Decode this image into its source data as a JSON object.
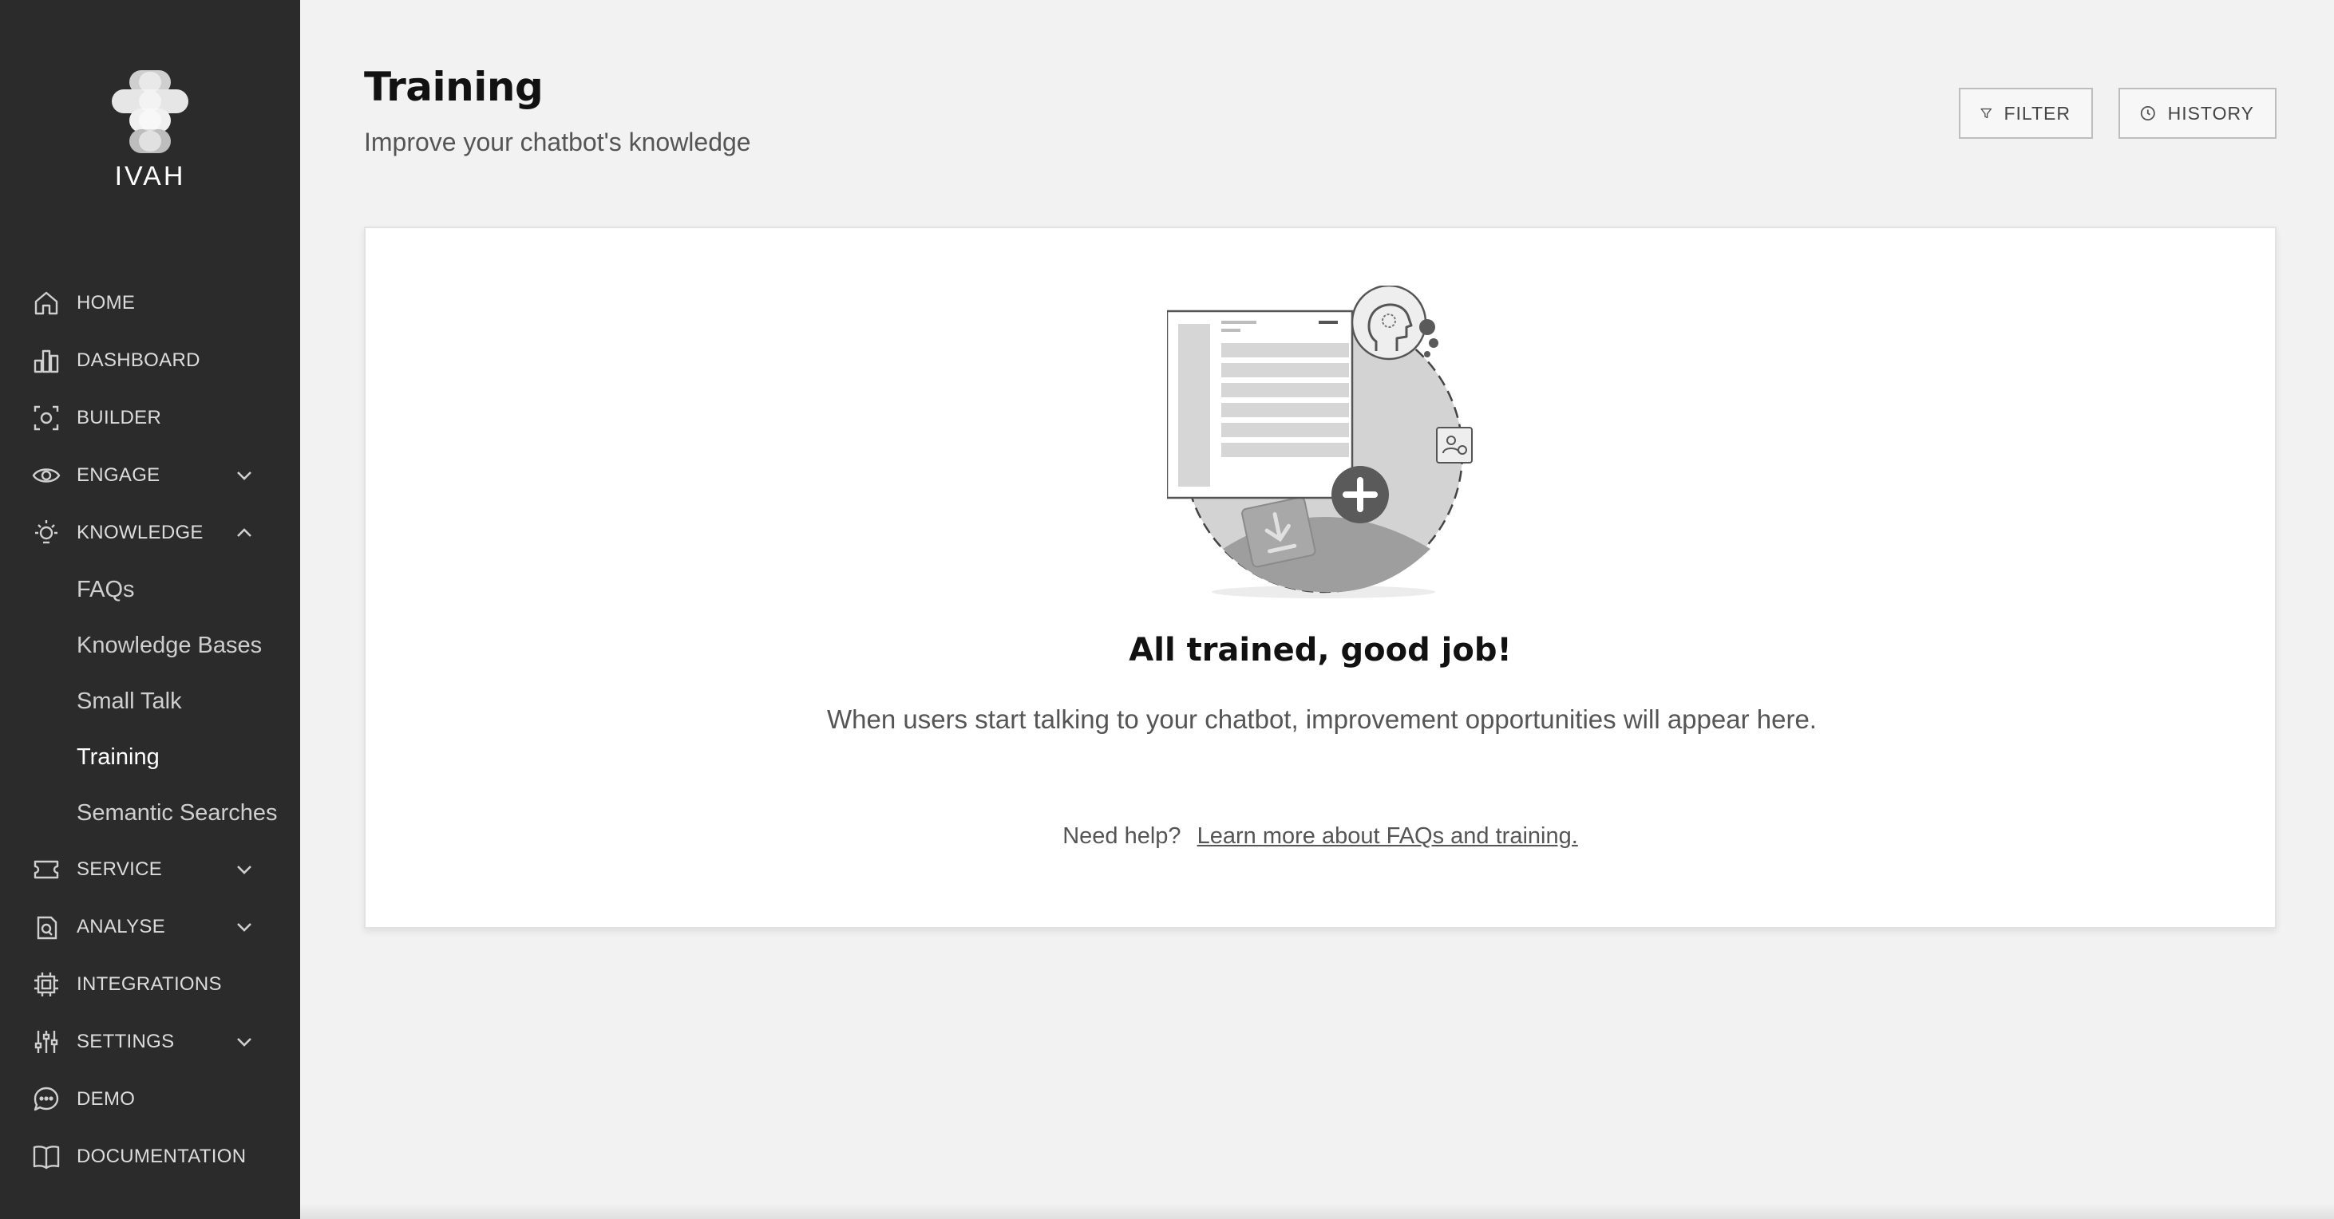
{
  "brand": {
    "name": "IVAH",
    "logo": "ivah-logo"
  },
  "sidebar": {
    "items": [
      {
        "label": "HOME",
        "icon": "home-icon"
      },
      {
        "label": "DASHBOARD",
        "icon": "bar-chart-icon"
      },
      {
        "label": "BUILDER",
        "icon": "builder-icon"
      },
      {
        "label": "ENGAGE",
        "icon": "eye-icon",
        "expanded": false
      },
      {
        "label": "KNOWLEDGE",
        "icon": "lightbulb-icon",
        "expanded": true,
        "children": [
          {
            "label": "FAQs"
          },
          {
            "label": "Knowledge Bases"
          },
          {
            "label": "Small Talk"
          },
          {
            "label": "Training",
            "active": true
          },
          {
            "label": "Semantic Searches"
          }
        ]
      },
      {
        "label": "SERVICE",
        "icon": "ticket-icon",
        "expanded": false
      },
      {
        "label": "ANALYSE",
        "icon": "analyse-icon",
        "expanded": false
      },
      {
        "label": "INTEGRATIONS",
        "icon": "chip-icon"
      },
      {
        "label": "SETTINGS",
        "icon": "sliders-icon",
        "expanded": false
      },
      {
        "label": "DEMO",
        "icon": "chat-bubble-icon"
      },
      {
        "label": "DOCUMENTATION",
        "icon": "book-icon"
      }
    ]
  },
  "header": {
    "title": "Training",
    "subtitle": "Improve your chatbot's knowledge",
    "filter_label": "FILTER",
    "history_label": "HISTORY"
  },
  "empty_state": {
    "title": "All trained, good job!",
    "description": "When users start talking to your chatbot, improvement opportunities will appear here.",
    "help_prefix": "Need help?",
    "help_link": "Learn more about FAQs and training."
  },
  "colors": {
    "sidebar_bg": "#2b2b2b",
    "page_bg": "#f2f2f2",
    "card_bg": "#ffffff",
    "active_text": "#ffffff"
  }
}
